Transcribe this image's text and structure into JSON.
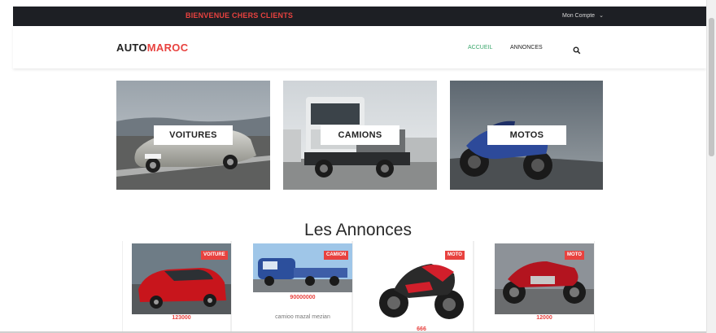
{
  "topbar": {
    "welcome": "BIENVENUE CHERS CLIENTS",
    "account": "Mon Compte",
    "account_icon": "chevron-down-icon"
  },
  "navbar": {
    "logo_part1": "AUTO",
    "logo_part2": "MAROC",
    "items": [
      {
        "label": "ACCUEIL",
        "active": true
      },
      {
        "label": "ANNONCES",
        "active": false
      }
    ],
    "search_icon": "search-icon"
  },
  "categories": [
    {
      "label": "VOITURES"
    },
    {
      "label": "CAMIONS"
    },
    {
      "label": "MOTOS"
    }
  ],
  "annonces": {
    "title": "Les Annonces",
    "cards": [
      {
        "badge": "VOITURE",
        "price": "123000",
        "desc": ""
      },
      {
        "badge": "CAMION",
        "price": "90000000",
        "desc": "camioo mazal mezian"
      },
      {
        "badge": "MOTO",
        "price": "666",
        "desc": ""
      },
      {
        "badge": "MOTO",
        "price": "12000",
        "desc": ""
      }
    ]
  },
  "colors": {
    "accent": "#e8423f",
    "active_nav": "#3aa66b",
    "topbar_bg": "#1d1f24"
  }
}
